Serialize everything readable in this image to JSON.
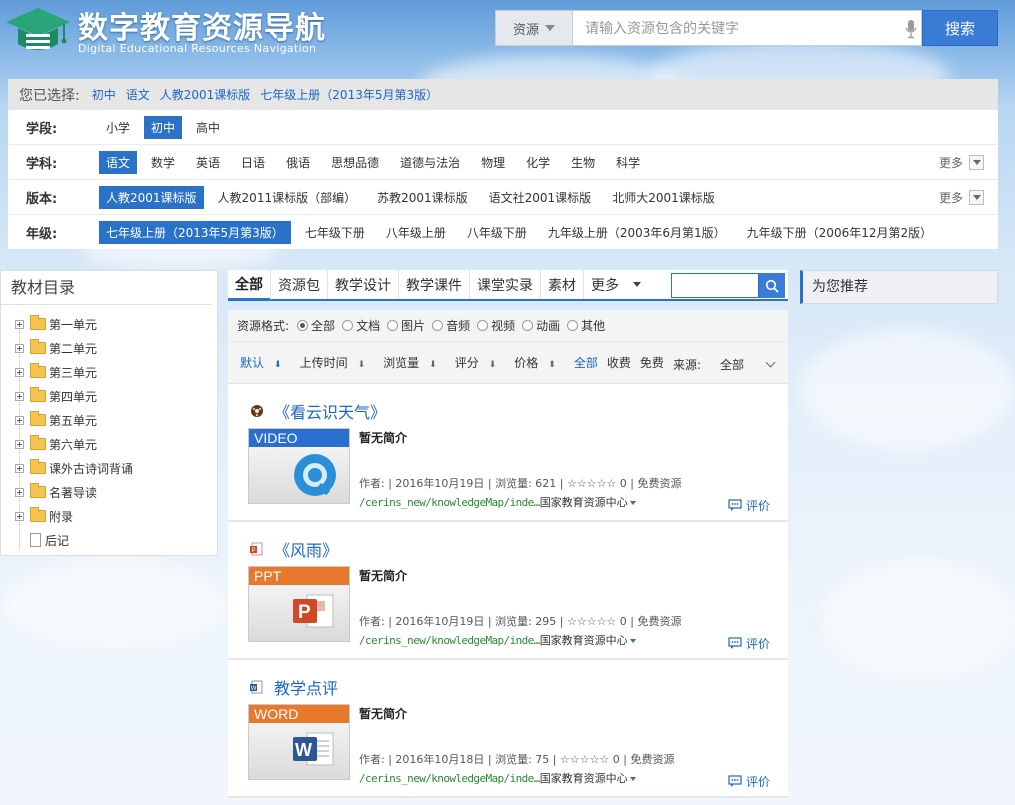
{
  "header": {
    "title": "数字教育资源导航",
    "subtitle": "Digital Educational Resources Navigation",
    "search_type": "资源",
    "search_placeholder": "请输入资源包含的关键字",
    "search_button": "搜索"
  },
  "selection": {
    "label": "您已选择:",
    "crumbs": [
      "初中",
      "语文",
      "人教2001课标版",
      "七年级上册（2013年5月第3版）"
    ]
  },
  "filters": {
    "stage": {
      "label": "学段:",
      "options": [
        "小学",
        "初中",
        "高中"
      ],
      "selected": "初中"
    },
    "subject": {
      "label": "学科:",
      "options": [
        "语文",
        "数学",
        "英语",
        "日语",
        "俄语",
        "思想品德",
        "道德与法治",
        "物理",
        "化学",
        "生物",
        "科学"
      ],
      "selected": "语文",
      "more": "更多"
    },
    "edition": {
      "label": "版本:",
      "options": [
        "人教2001课标版",
        "人教2011课标版（部编）",
        "苏教2001课标版",
        "语文社2001课标版",
        "北师大2001课标版"
      ],
      "selected": "人教2001课标版",
      "more": "更多"
    },
    "grade": {
      "label": "年级:",
      "options": [
        "七年级上册（2013年5月第3版）",
        "七年级下册",
        "八年级上册",
        "八年级下册",
        "九年级上册（2003年6月第1版）",
        "九年级下册（2006年12月第2版）"
      ],
      "selected": "七年级上册（2013年5月第3版）"
    }
  },
  "tree": {
    "title": "教材目录",
    "items": [
      "第一单元",
      "第二单元",
      "第三单元",
      "第四单元",
      "第五单元",
      "第六单元",
      "课外古诗词背诵",
      "名著导读",
      "附录",
      "后记"
    ]
  },
  "tabs": [
    "全部",
    "资源包",
    "教学设计",
    "教学课件",
    "课堂实录",
    "素材",
    "更多"
  ],
  "format": {
    "label": "资源格式:",
    "options": [
      "全部",
      "文档",
      "图片",
      "音频",
      "视频",
      "动画",
      "其他"
    ],
    "selected": "全部"
  },
  "sort": {
    "default": "默认",
    "upload_time": "上传时间",
    "views": "浏览量",
    "score": "评分",
    "price": "价格",
    "all": "全部",
    "paid": "收费",
    "free": "免费",
    "source_label": "来源:",
    "source_value": "全部"
  },
  "icons": {
    "search": "search-icon",
    "mic": "microphone-icon",
    "logo": "graduation-cap-icon"
  },
  "colors": {
    "accent": "#2a72c8",
    "video_band": "#2a6fd0",
    "ppt_band": "#e8792c",
    "word_band": "#e8792c",
    "url_green": "#2b8a33"
  },
  "results": [
    {
      "title": "《看云识天气》",
      "type_icon": "video-file-icon",
      "thumb_label": "VIDEO",
      "summary": "暂无简介",
      "meta": "作者:    | 2016年10月19日 | 浏览量: 621 | ☆☆☆☆☆ 0 | 免费资源",
      "url": "/cerins_new/knowledgeMap/inde…",
      "org": "国家教育资源中心",
      "rate_label": "评价"
    },
    {
      "title": "《风雨》",
      "type_icon": "ppt-file-icon",
      "thumb_label": "PPT",
      "summary": "暂无简介",
      "meta": "作者:    | 2016年10月19日 | 浏览量: 295 | ☆☆☆☆☆ 0 | 免费资源",
      "url": "/cerins_new/knowledgeMap/inde…",
      "org": "国家教育资源中心",
      "rate_label": "评价"
    },
    {
      "title": "教学点评",
      "type_icon": "word-file-icon",
      "thumb_label": "WORD",
      "summary": "暂无简介",
      "meta": "作者:    | 2016年10月18日 | 浏览量: 75 | ☆☆☆☆☆ 0 | 免费资源",
      "url": "/cerins_new/knowledgeMap/inde…",
      "org": "国家教育资源中心",
      "rate_label": "评价"
    }
  ],
  "recommend": {
    "title": "为您推荐"
  }
}
